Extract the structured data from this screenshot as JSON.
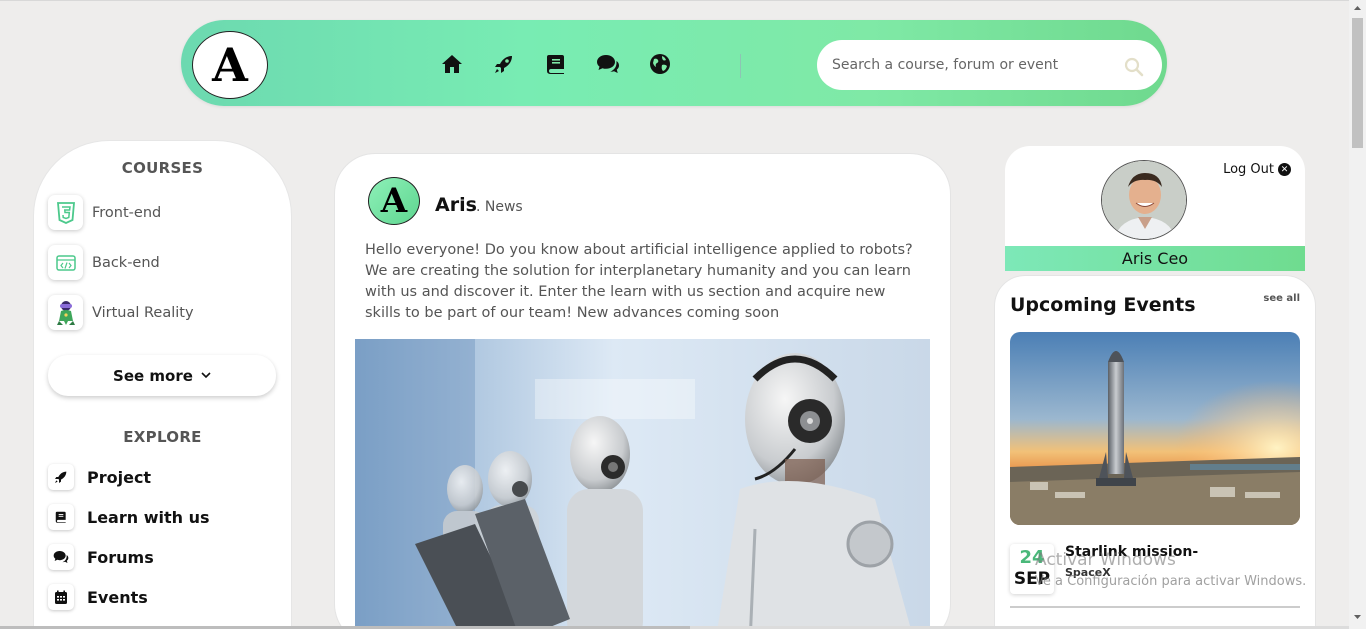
{
  "header": {
    "logo_letter": "A",
    "nav": [
      {
        "name": "home-icon"
      },
      {
        "name": "rocket-icon"
      },
      {
        "name": "book-icon"
      },
      {
        "name": "chat-bubbles-icon"
      },
      {
        "name": "globe-icon"
      }
    ],
    "search": {
      "placeholder": "Search a course, forum or event",
      "value": ""
    },
    "accent_gradient": [
      "#6cd9b0",
      "#6fd98e"
    ]
  },
  "sidebar": {
    "courses_title": "COURSES",
    "courses": [
      {
        "label": "Front-end",
        "icon": "html5-icon"
      },
      {
        "label": "Back-end",
        "icon": "code-window-icon"
      },
      {
        "label": "Virtual Reality",
        "icon": "vr-character-icon"
      }
    ],
    "see_more_label": "See more",
    "explore_title": "EXPLORE",
    "explore": [
      {
        "label": "Project",
        "icon": "rocket-icon"
      },
      {
        "label": "Learn with us",
        "icon": "book-icon"
      },
      {
        "label": "Forums",
        "icon": "chat-bubbles-icon"
      },
      {
        "label": "Events",
        "icon": "calendar-icon"
      }
    ]
  },
  "post": {
    "avatar_letter": "A",
    "author": "Aris",
    "category": ". News",
    "text": "Hello everyone! Do you know about artificial intelligence applied to robots? We are creating the solution for interplanetary humanity and you can learn with us and discover it. Enter the learn with us section and acquire new skills to be part of our team! New advances coming soon"
  },
  "profile": {
    "logout_label": "Log Out",
    "name": "Aris Ceo"
  },
  "events": {
    "title": "Upcoming Events",
    "see_all_label": "see all",
    "items": [
      {
        "day": "24",
        "month": "SEP",
        "name": "Starlink mission-",
        "organizer": "SpaceX"
      }
    ]
  },
  "watermark": {
    "line1": "Activar Windows",
    "line2": "Ve a Configuración para activar Windows."
  }
}
